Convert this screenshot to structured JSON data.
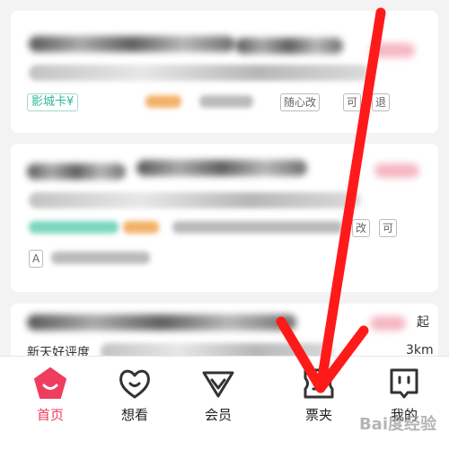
{
  "cards": [
    {
      "tag_label": "影城卡",
      "price_prefix": "¥",
      "tags": [
        "随心改",
        "可",
        "退"
      ]
    },
    {
      "tags": [
        "改",
        "可"
      ],
      "badge": "A"
    },
    {
      "subtitle": "新天好评度",
      "distance": "3km",
      "side_char": "起"
    }
  ],
  "tabbar": {
    "items": [
      {
        "label": "首页",
        "icon": "home-icon",
        "active": true
      },
      {
        "label": "想看",
        "icon": "heart-icon",
        "active": false
      },
      {
        "label": "会员",
        "icon": "member-icon",
        "active": false
      },
      {
        "label": "票夹",
        "icon": "ticket-icon",
        "active": false
      },
      {
        "label": "我的",
        "icon": "profile-icon",
        "active": false
      }
    ]
  },
  "watermark": "Bai度经验",
  "colors": {
    "accent": "#f03d5f",
    "arrow": "#ff1a1a",
    "tag_green": "#2bb89a"
  }
}
